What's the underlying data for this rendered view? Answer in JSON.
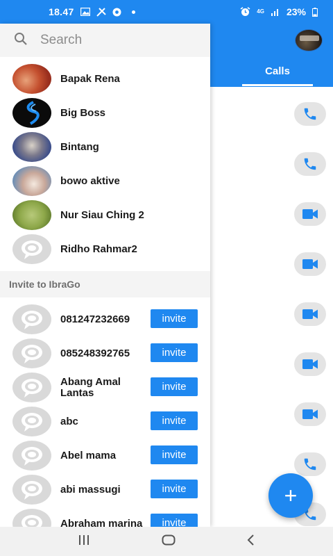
{
  "status_bar": {
    "time": "18.47",
    "network": "4G",
    "battery": "23%"
  },
  "search": {
    "placeholder": "Search"
  },
  "contacts": [
    {
      "name": "Bapak Rena"
    },
    {
      "name": "Big Boss"
    },
    {
      "name": "Bintang"
    },
    {
      "name": "bowo aktive"
    },
    {
      "name": "Nur Siau Ching 2"
    },
    {
      "name": "Ridho Rahmar2"
    }
  ],
  "invite_section": {
    "title": "Invite to IbraGo",
    "button_label": "invite",
    "items": [
      {
        "name": "081247232669"
      },
      {
        "name": "085248392765"
      },
      {
        "name": "Abang Amal Lantas"
      },
      {
        "name": "abc"
      },
      {
        "name": "Abel mama"
      },
      {
        "name": "abi massugi"
      },
      {
        "name": "Abraham marina"
      }
    ]
  },
  "calls_tab": {
    "label": "Calls"
  },
  "call_buttons": [
    "phone-icon",
    "phone-icon",
    "video-icon",
    "video-icon",
    "video-icon",
    "video-icon",
    "video-icon",
    "phone-icon",
    "phone-icon"
  ],
  "fab": {
    "label": "+"
  },
  "nav": {
    "recents": "|||",
    "home": "◯",
    "back": "<"
  },
  "colors": {
    "primary": "#1f88f0",
    "call_button_bg": "#e4e4e4",
    "section_bg": "#f4f4f4"
  }
}
